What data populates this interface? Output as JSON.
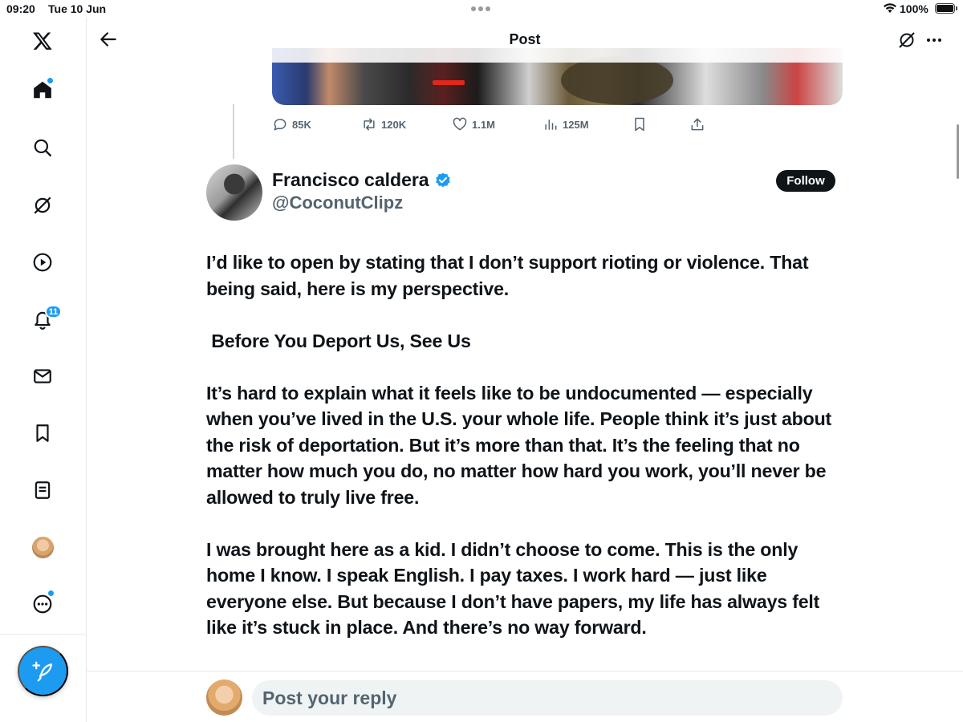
{
  "status_bar": {
    "time": "09:20",
    "date": "Tue 10 Jun",
    "battery": "100%"
  },
  "header": {
    "title": "Post"
  },
  "sidebar": {
    "items": [
      {
        "name": "x-logo-icon"
      },
      {
        "name": "home-icon"
      },
      {
        "name": "search-icon"
      },
      {
        "name": "grok-icon"
      },
      {
        "name": "video-icon"
      },
      {
        "name": "notifications-icon"
      },
      {
        "name": "messages-icon"
      },
      {
        "name": "bookmarks-icon"
      },
      {
        "name": "lists-icon"
      },
      {
        "name": "profile-avatar"
      },
      {
        "name": "more-icon"
      }
    ],
    "notifications_count": "11"
  },
  "quoted_post": {
    "stats": {
      "replies": "85K",
      "reposts": "120K",
      "likes": "1.1M",
      "views": "125M"
    }
  },
  "post": {
    "author_name": "Francisco caldera",
    "author_handle": "@CoconutClipz",
    "follow_label": "Follow",
    "paragraphs": [
      "I’d like to open by stating that I don’t support rioting or violence. That being said, here is my perspective.",
      " Before You Deport Us, See Us",
      "It’s hard to explain what it feels like to be undocumented — especially when you’ve lived in the U.S. your whole life. People think it’s just about the risk of deportation. But it’s more than that. It’s the feeling that no matter how much you do, no matter how hard you work, you’ll never be allowed to truly live free.",
      "I was brought here as a kid. I didn’t choose to come. This is the only home I know. I speak English. I pay taxes. I work hard — just like everyone else. But because I don’t have papers, my life has always felt like it’s stuck in place. And there’s no way forward."
    ]
  },
  "reply": {
    "placeholder": "Post your reply"
  },
  "colors": {
    "accent": "#1d9bf0",
    "text": "#0f1419",
    "muted": "#536471"
  }
}
